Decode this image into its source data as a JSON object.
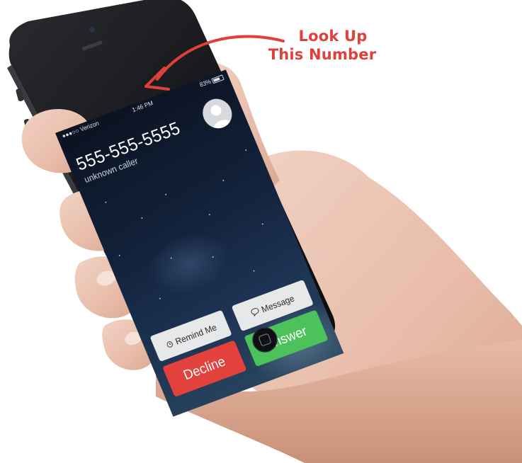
{
  "annotation": {
    "line1": "Look Up",
    "line2": "This Number",
    "color": "#e0403a"
  },
  "status_bar": {
    "carrier": "Verizon",
    "time": "1:46 PM",
    "battery": "83%",
    "icons": [
      "signal-icon",
      "wifi-icon",
      "battery-icon"
    ]
  },
  "caller": {
    "number": "555-555-5555",
    "label": "unknown caller",
    "avatar_icon": "person-silhouette-icon"
  },
  "actions": {
    "remind_label": "Remind Me",
    "remind_icon": "alarm-clock-icon",
    "message_label": "Message",
    "message_icon": "speech-bubble-icon",
    "decline_label": "Decline",
    "answer_label": "Answer",
    "decline_color": "#e3413b",
    "answer_color": "#4cc35a"
  },
  "home_button": {
    "icon": "home-square-icon"
  }
}
